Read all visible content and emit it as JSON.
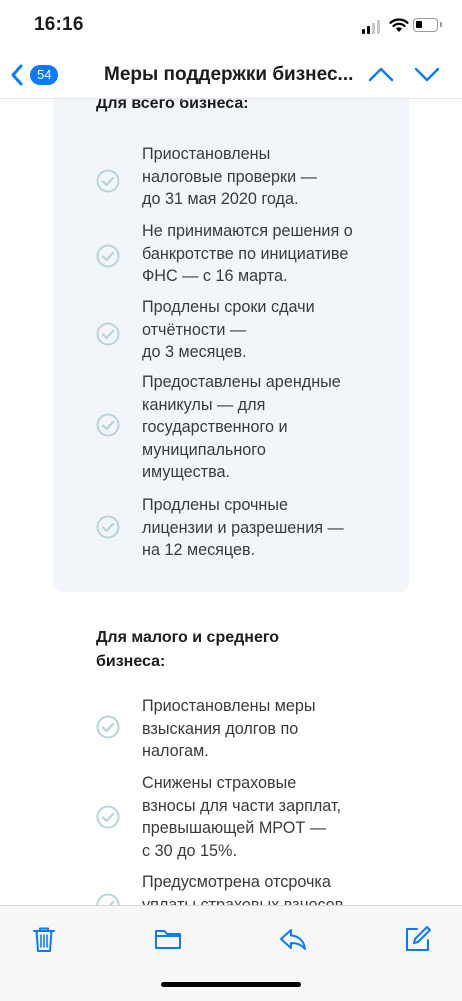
{
  "status_bar": {
    "time": "16:16"
  },
  "nav": {
    "badge_count": "54",
    "title": "Меры поддержки бизнес..."
  },
  "sections": [
    {
      "heading": "Для всего бизнеса:",
      "items": [
        "Приостановлены\nналоговые проверки —\nдо 31 мая 2020 года.",
        "Не принимаются решения о\nбанкротстве по инициативе\nФНС — с 16 марта.",
        "Продлены сроки сдачи\nотчётности —\nдо 3 месяцев.",
        "Предоставлены арендные\nканикулы — для\nгосударственного и\nмуниципального\nимущества.",
        "Продлены срочные\nлицензии и разрешения —\nна 12 месяцев."
      ]
    },
    {
      "heading": "Для малого и среднего\nбизнеса:",
      "items": [
        "Приостановлены меры\nвзыскания долгов по\nналогам.",
        "Снижены страховые\nвзносы для части зарплат,\nпревышающей МРОТ —\nс 30 до 15%.",
        "Предусмотрена отсрочка\nуплаты страховых взносов"
      ]
    }
  ],
  "toolbar": {
    "icons": [
      "trash-icon",
      "folder-icon",
      "reply-icon",
      "compose-icon"
    ]
  },
  "colors": {
    "accent": "#0a7aff",
    "card_bg": "#f2f6fb",
    "check_icon": "#b9d4d8"
  }
}
